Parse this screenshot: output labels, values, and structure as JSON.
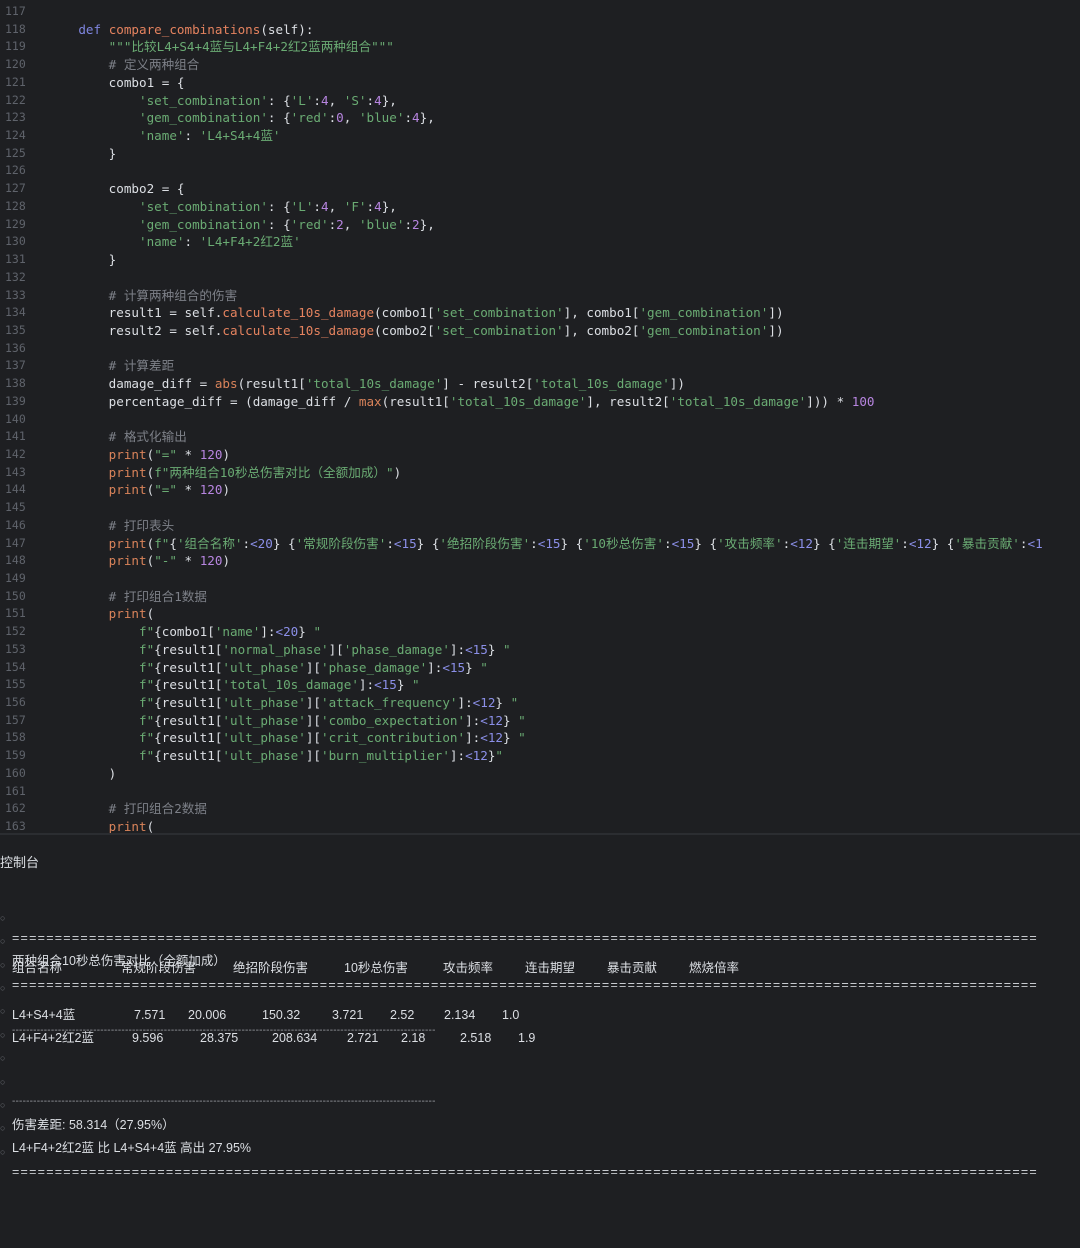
{
  "editor": {
    "lines": [
      {
        "num": "117",
        "tokens": []
      },
      {
        "num": "118",
        "tokens": [
          [
            "t",
            "    "
          ],
          [
            "kw",
            "def"
          ],
          [
            "t",
            " "
          ],
          [
            "fn",
            "compare_combinations"
          ],
          [
            "t",
            "(self):"
          ]
        ]
      },
      {
        "num": "119",
        "tokens": [
          [
            "t",
            "        "
          ],
          [
            "s",
            "\"\"\"比较L4+S4+4蓝与L4+F4+2红2蓝两种组合\"\"\""
          ]
        ]
      },
      {
        "num": "120",
        "tokens": [
          [
            "t",
            "        "
          ],
          [
            "c",
            "# 定义两种组合"
          ]
        ]
      },
      {
        "num": "121",
        "tokens": [
          [
            "t",
            "        combo1 = {"
          ]
        ]
      },
      {
        "num": "122",
        "tokens": [
          [
            "t",
            "            "
          ],
          [
            "s",
            "'set_combination'"
          ],
          [
            "t",
            ": {"
          ],
          [
            "s",
            "'L'"
          ],
          [
            "t",
            ":"
          ],
          [
            "n",
            "4"
          ],
          [
            "t",
            ", "
          ],
          [
            "s",
            "'S'"
          ],
          [
            "t",
            ":"
          ],
          [
            "n",
            "4"
          ],
          [
            "t",
            "},"
          ]
        ]
      },
      {
        "num": "123",
        "tokens": [
          [
            "t",
            "            "
          ],
          [
            "s",
            "'gem_combination'"
          ],
          [
            "t",
            ": {"
          ],
          [
            "s",
            "'red'"
          ],
          [
            "t",
            ":"
          ],
          [
            "n",
            "0"
          ],
          [
            "t",
            ", "
          ],
          [
            "s",
            "'blue'"
          ],
          [
            "t",
            ":"
          ],
          [
            "n",
            "4"
          ],
          [
            "t",
            "},"
          ]
        ]
      },
      {
        "num": "124",
        "tokens": [
          [
            "t",
            "            "
          ],
          [
            "s",
            "'name'"
          ],
          [
            "t",
            ": "
          ],
          [
            "s",
            "'L4+S4+4蓝'"
          ]
        ]
      },
      {
        "num": "125",
        "tokens": [
          [
            "t",
            "        }"
          ]
        ]
      },
      {
        "num": "126",
        "tokens": []
      },
      {
        "num": "127",
        "tokens": [
          [
            "t",
            "        combo2 = {"
          ]
        ]
      },
      {
        "num": "128",
        "tokens": [
          [
            "t",
            "            "
          ],
          [
            "s",
            "'set_combination'"
          ],
          [
            "t",
            ": {"
          ],
          [
            "s",
            "'L'"
          ],
          [
            "t",
            ":"
          ],
          [
            "n",
            "4"
          ],
          [
            "t",
            ", "
          ],
          [
            "s",
            "'F'"
          ],
          [
            "t",
            ":"
          ],
          [
            "n",
            "4"
          ],
          [
            "t",
            "},"
          ]
        ]
      },
      {
        "num": "129",
        "tokens": [
          [
            "t",
            "            "
          ],
          [
            "s",
            "'gem_combination'"
          ],
          [
            "t",
            ": {"
          ],
          [
            "s",
            "'red'"
          ],
          [
            "t",
            ":"
          ],
          [
            "n",
            "2"
          ],
          [
            "t",
            ", "
          ],
          [
            "s",
            "'blue'"
          ],
          [
            "t",
            ":"
          ],
          [
            "n",
            "2"
          ],
          [
            "t",
            "},"
          ]
        ]
      },
      {
        "num": "130",
        "tokens": [
          [
            "t",
            "            "
          ],
          [
            "s",
            "'name'"
          ],
          [
            "t",
            ": "
          ],
          [
            "s",
            "'L4+F4+2红2蓝'"
          ]
        ]
      },
      {
        "num": "131",
        "tokens": [
          [
            "t",
            "        }"
          ]
        ]
      },
      {
        "num": "132",
        "tokens": []
      },
      {
        "num": "133",
        "tokens": [
          [
            "t",
            "        "
          ],
          [
            "c",
            "# 计算两种组合的伤害"
          ]
        ]
      },
      {
        "num": "134",
        "tokens": [
          [
            "t",
            "        result1 = self."
          ],
          [
            "fn",
            "calculate_10s_damage"
          ],
          [
            "t",
            "(combo1["
          ],
          [
            "s",
            "'set_combination'"
          ],
          [
            "t",
            "], combo1["
          ],
          [
            "s",
            "'gem_combination'"
          ],
          [
            "t",
            "])"
          ]
        ]
      },
      {
        "num": "135",
        "tokens": [
          [
            "t",
            "        result2 = self."
          ],
          [
            "fn",
            "calculate_10s_damage"
          ],
          [
            "t",
            "(combo2["
          ],
          [
            "s",
            "'set_combination'"
          ],
          [
            "t",
            "], combo2["
          ],
          [
            "s",
            "'gem_combination'"
          ],
          [
            "t",
            "])"
          ]
        ]
      },
      {
        "num": "136",
        "tokens": []
      },
      {
        "num": "137",
        "tokens": [
          [
            "t",
            "        "
          ],
          [
            "c",
            "# 计算差距"
          ]
        ]
      },
      {
        "num": "138",
        "tokens": [
          [
            "t",
            "        damage_diff = "
          ],
          [
            "p",
            "abs"
          ],
          [
            "t",
            "(result1["
          ],
          [
            "s",
            "'total_10s_damage'"
          ],
          [
            "t",
            "] - result2["
          ],
          [
            "s",
            "'total_10s_damage'"
          ],
          [
            "t",
            "])"
          ]
        ]
      },
      {
        "num": "139",
        "tokens": [
          [
            "t",
            "        percentage_diff = (damage_diff / "
          ],
          [
            "p",
            "max"
          ],
          [
            "t",
            "(result1["
          ],
          [
            "s",
            "'total_10s_damage'"
          ],
          [
            "t",
            "], result2["
          ],
          [
            "s",
            "'total_10s_damage'"
          ],
          [
            "t",
            "])) * "
          ],
          [
            "n",
            "100"
          ]
        ]
      },
      {
        "num": "140",
        "tokens": []
      },
      {
        "num": "141",
        "tokens": [
          [
            "t",
            "        "
          ],
          [
            "c",
            "# 格式化输出"
          ]
        ]
      },
      {
        "num": "142",
        "tokens": [
          [
            "t",
            "        "
          ],
          [
            "p",
            "print"
          ],
          [
            "t",
            "("
          ],
          [
            "s",
            "\"=\""
          ],
          [
            "t",
            " * "
          ],
          [
            "n",
            "120"
          ],
          [
            "t",
            ")"
          ]
        ]
      },
      {
        "num": "143",
        "tokens": [
          [
            "t",
            "        "
          ],
          [
            "p",
            "print"
          ],
          [
            "t",
            "("
          ],
          [
            "s",
            "f\"两种组合10秒总伤害对比（全额加成）\""
          ],
          [
            "t",
            ")"
          ]
        ]
      },
      {
        "num": "144",
        "tokens": [
          [
            "t",
            "        "
          ],
          [
            "p",
            "print"
          ],
          [
            "t",
            "("
          ],
          [
            "s",
            "\"=\""
          ],
          [
            "t",
            " * "
          ],
          [
            "n",
            "120"
          ],
          [
            "t",
            ")"
          ]
        ]
      },
      {
        "num": "145",
        "tokens": []
      },
      {
        "num": "146",
        "tokens": [
          [
            "t",
            "        "
          ],
          [
            "c",
            "# 打印表头"
          ]
        ]
      },
      {
        "num": "147",
        "tokens": [
          [
            "t",
            "        "
          ],
          [
            "p",
            "print"
          ],
          [
            "t",
            "("
          ],
          [
            "s",
            "f\""
          ],
          [
            "t",
            "{"
          ],
          [
            "s",
            "'组合名称'"
          ],
          [
            "t",
            ":"
          ],
          [
            "f",
            "<20"
          ],
          [
            "t",
            "} {"
          ],
          [
            "s",
            "'常规阶段伤害'"
          ],
          [
            "t",
            ":"
          ],
          [
            "f",
            "<15"
          ],
          [
            "t",
            "} {"
          ],
          [
            "s",
            "'绝招阶段伤害'"
          ],
          [
            "t",
            ":"
          ],
          [
            "f",
            "<15"
          ],
          [
            "t",
            "} {"
          ],
          [
            "s",
            "'10秒总伤害'"
          ],
          [
            "t",
            ":"
          ],
          [
            "f",
            "<15"
          ],
          [
            "t",
            "} {"
          ],
          [
            "s",
            "'攻击频率'"
          ],
          [
            "t",
            ":"
          ],
          [
            "f",
            "<12"
          ],
          [
            "t",
            "} {"
          ],
          [
            "s",
            "'连击期望'"
          ],
          [
            "t",
            ":"
          ],
          [
            "f",
            "<12"
          ],
          [
            "t",
            "} {"
          ],
          [
            "s",
            "'暴击贡献'"
          ],
          [
            "t",
            ":"
          ],
          [
            "f",
            "<1"
          ]
        ]
      },
      {
        "num": "148",
        "tokens": [
          [
            "t",
            "        "
          ],
          [
            "p",
            "print"
          ],
          [
            "t",
            "("
          ],
          [
            "s",
            "\"-\""
          ],
          [
            "t",
            " * "
          ],
          [
            "n",
            "120"
          ],
          [
            "t",
            ")"
          ]
        ]
      },
      {
        "num": "149",
        "tokens": []
      },
      {
        "num": "150",
        "tokens": [
          [
            "t",
            "        "
          ],
          [
            "c",
            "# 打印组合1数据"
          ]
        ]
      },
      {
        "num": "151",
        "tokens": [
          [
            "t",
            "        "
          ],
          [
            "p",
            "print"
          ],
          [
            "t",
            "("
          ]
        ]
      },
      {
        "num": "152",
        "tokens": [
          [
            "t",
            "            "
          ],
          [
            "s",
            "f\""
          ],
          [
            "t",
            "{combo1["
          ],
          [
            "s",
            "'name'"
          ],
          [
            "t",
            "]:"
          ],
          [
            "f",
            "<20"
          ],
          [
            "t",
            "}"
          ],
          [
            "s",
            " \""
          ]
        ]
      },
      {
        "num": "153",
        "tokens": [
          [
            "t",
            "            "
          ],
          [
            "s",
            "f\""
          ],
          [
            "t",
            "{result1["
          ],
          [
            "s",
            "'normal_phase'"
          ],
          [
            "t",
            "]["
          ],
          [
            "s",
            "'phase_damage'"
          ],
          [
            "t",
            "]:"
          ],
          [
            "f",
            "<15"
          ],
          [
            "t",
            "}"
          ],
          [
            "s",
            " \""
          ]
        ]
      },
      {
        "num": "154",
        "tokens": [
          [
            "t",
            "            "
          ],
          [
            "s",
            "f\""
          ],
          [
            "t",
            "{result1["
          ],
          [
            "s",
            "'ult_phase'"
          ],
          [
            "t",
            "]["
          ],
          [
            "s",
            "'phase_damage'"
          ],
          [
            "t",
            "]:"
          ],
          [
            "f",
            "<15"
          ],
          [
            "t",
            "}"
          ],
          [
            "s",
            " \""
          ]
        ]
      },
      {
        "num": "155",
        "tokens": [
          [
            "t",
            "            "
          ],
          [
            "s",
            "f\""
          ],
          [
            "t",
            "{result1["
          ],
          [
            "s",
            "'total_10s_damage'"
          ],
          [
            "t",
            "]:"
          ],
          [
            "f",
            "<15"
          ],
          [
            "t",
            "}"
          ],
          [
            "s",
            " \""
          ]
        ]
      },
      {
        "num": "156",
        "tokens": [
          [
            "t",
            "            "
          ],
          [
            "s",
            "f\""
          ],
          [
            "t",
            "{result1["
          ],
          [
            "s",
            "'ult_phase'"
          ],
          [
            "t",
            "]["
          ],
          [
            "s",
            "'attack_frequency'"
          ],
          [
            "t",
            "]:"
          ],
          [
            "f",
            "<12"
          ],
          [
            "t",
            "}"
          ],
          [
            "s",
            " \""
          ]
        ]
      },
      {
        "num": "157",
        "tokens": [
          [
            "t",
            "            "
          ],
          [
            "s",
            "f\""
          ],
          [
            "t",
            "{result1["
          ],
          [
            "s",
            "'ult_phase'"
          ],
          [
            "t",
            "]["
          ],
          [
            "s",
            "'combo_expectation'"
          ],
          [
            "t",
            "]:"
          ],
          [
            "f",
            "<12"
          ],
          [
            "t",
            "}"
          ],
          [
            "s",
            " \""
          ]
        ]
      },
      {
        "num": "158",
        "tokens": [
          [
            "t",
            "            "
          ],
          [
            "s",
            "f\""
          ],
          [
            "t",
            "{result1["
          ],
          [
            "s",
            "'ult_phase'"
          ],
          [
            "t",
            "]["
          ],
          [
            "s",
            "'crit_contribution'"
          ],
          [
            "t",
            "]:"
          ],
          [
            "f",
            "<12"
          ],
          [
            "t",
            "}"
          ],
          [
            "s",
            " \""
          ]
        ]
      },
      {
        "num": "159",
        "tokens": [
          [
            "t",
            "            "
          ],
          [
            "s",
            "f\""
          ],
          [
            "t",
            "{result1["
          ],
          [
            "s",
            "'ult_phase'"
          ],
          [
            "t",
            "]["
          ],
          [
            "s",
            "'burn_multiplier'"
          ],
          [
            "t",
            "]:"
          ],
          [
            "f",
            "<12"
          ],
          [
            "t",
            "}"
          ],
          [
            "s",
            "\""
          ]
        ]
      },
      {
        "num": "160",
        "tokens": [
          [
            "t",
            "        )"
          ]
        ]
      },
      {
        "num": "161",
        "tokens": []
      },
      {
        "num": "162",
        "tokens": [
          [
            "t",
            "        "
          ],
          [
            "c",
            "# 打印组合2数据"
          ]
        ]
      },
      {
        "num": "163",
        "tokens": [
          [
            "t",
            "        "
          ],
          [
            "p",
            "print"
          ],
          [
            "t",
            "("
          ]
        ]
      }
    ]
  },
  "console": {
    "title": "控制台",
    "bullet": "○",
    "equals_line": "========================================================================================================================",
    "dash_line": "------------------------------------------------------------------------------------------------------------------------",
    "heading": "两种组合10秒总伤害对比（全额加成）",
    "headers": [
      "组合名称",
      "常规阶段伤害",
      "绝招阶段伤害",
      "10秒总伤害",
      "攻击频率",
      "连击期望",
      "暴击贡献",
      "燃烧倍率"
    ],
    "rows": [
      [
        "L4+S4+4蓝",
        "7.571",
        "20.006",
        "150.32",
        "3.721",
        "2.52",
        "2.134",
        "1.0"
      ],
      [
        "L4+F4+2红2蓝",
        "9.596",
        "28.375",
        "208.634",
        "2.721",
        "2.18",
        "2.518",
        "1.9"
      ]
    ],
    "diff_text": "伤害差距: 58.314（27.95%）",
    "conclusion_text": "L4+F4+2红2蓝 比 L4+S4+4蓝 高出 27.95%"
  }
}
